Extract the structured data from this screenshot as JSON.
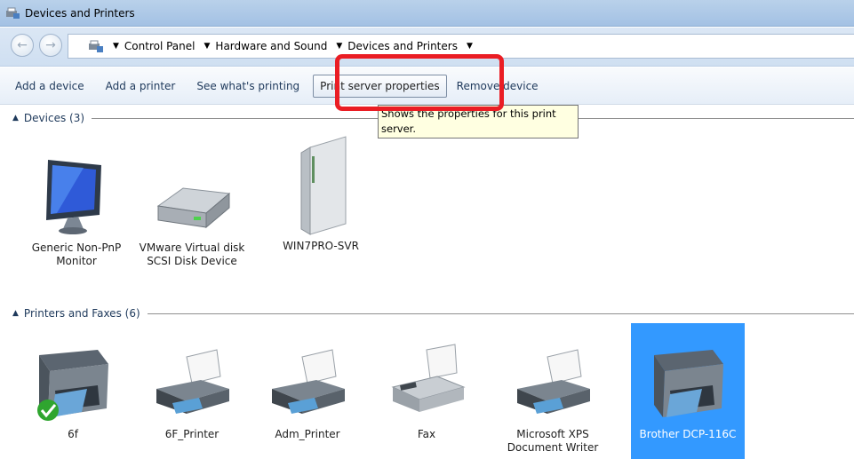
{
  "window": {
    "title": "Devices and Printers"
  },
  "address": {
    "breadcrumbs": [
      "Control Panel",
      "Hardware and Sound",
      "Devices and Printers"
    ]
  },
  "commands": {
    "add_device": "Add a device",
    "add_printer": "Add a printer",
    "see_printing": "See what's printing",
    "print_server": "Print server properties",
    "remove_device": "Remove device"
  },
  "tooltip": {
    "line1": "Shows the properties for this print",
    "line2": "server."
  },
  "groups": {
    "devices": {
      "header": "Devices (3)",
      "items": [
        {
          "label": "Generic Non-PnP Monitor",
          "icon": "monitor-icon"
        },
        {
          "label": "VMware Virtual disk SCSI Disk Device",
          "icon": "hard-disk-icon"
        },
        {
          "label": "WIN7PRO-SVR",
          "icon": "computer-tower-icon"
        }
      ]
    },
    "printers": {
      "header": "Printers and Faxes (6)",
      "items": [
        {
          "label": "6f",
          "icon": "multifunction-printer-icon",
          "default": true
        },
        {
          "label": "6F_Printer",
          "icon": "printer-icon"
        },
        {
          "label": "Adm_Printer",
          "icon": "printer-icon"
        },
        {
          "label": "Fax",
          "icon": "fax-icon"
        },
        {
          "label": "Microsoft XPS Document Writer",
          "icon": "printer-icon"
        },
        {
          "label": "Brother DCP-116C",
          "icon": "multifunction-printer-icon",
          "selected": true
        }
      ]
    }
  },
  "colors": {
    "selection": "#3399ff",
    "highlight": "#ea1d24",
    "tooltip_bg": "#ffffe1"
  }
}
